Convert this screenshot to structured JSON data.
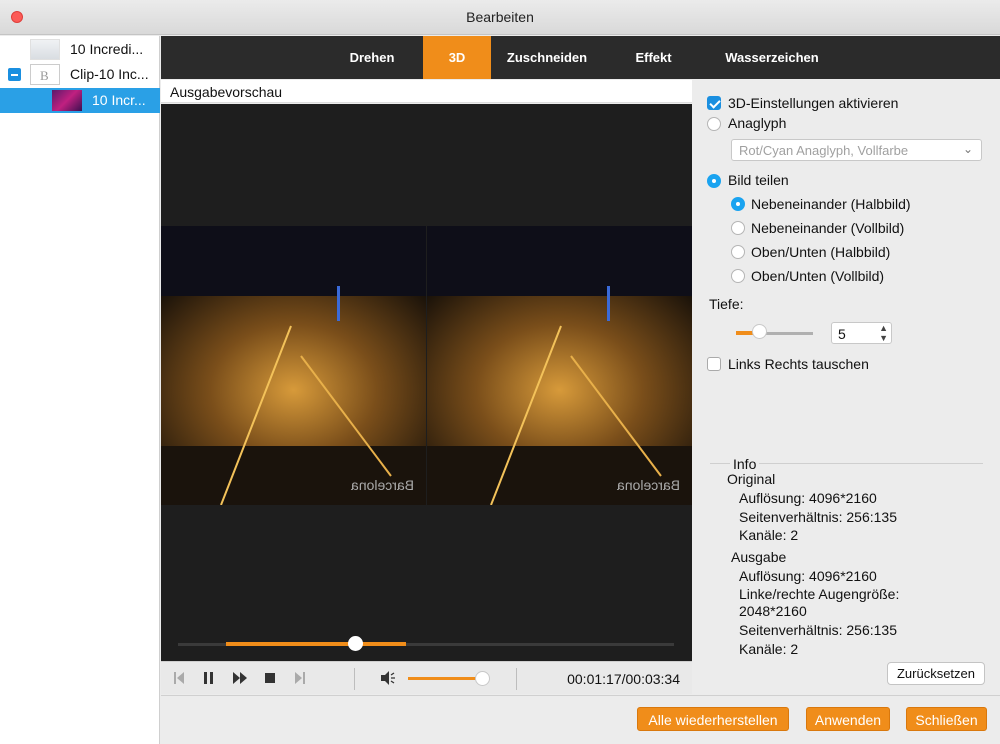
{
  "window": {
    "title": "Bearbeiten"
  },
  "sidebar": {
    "items": [
      {
        "label": "10 Incredi..."
      },
      {
        "label": "Clip-10 Inc..."
      },
      {
        "label": "10 Incr..."
      }
    ]
  },
  "tabs": [
    {
      "label": "Drehen"
    },
    {
      "label": "3D"
    },
    {
      "label": "Zuschneiden"
    },
    {
      "label": "Effekt"
    },
    {
      "label": "Wasserzeichen"
    }
  ],
  "active_tab": "3D",
  "preview": {
    "label": "Ausgabevorschau",
    "watermark_text": "Barcelona",
    "seek_progress": 0.36,
    "volume_level": 0.85,
    "time": "00:01:17/00:03:34"
  },
  "settings": {
    "enable_3d": {
      "label": "3D-Einstellungen aktivieren",
      "checked": true
    },
    "anaglyph": {
      "label": "Anaglyph",
      "selected": false
    },
    "anaglyph_select": {
      "value": "Rot/Cyan Anaglyph, Vollfarbe"
    },
    "split": {
      "label": "Bild teilen",
      "selected": true
    },
    "split_options": [
      {
        "label": "Nebeneinander (Halbbild)",
        "selected": true
      },
      {
        "label": "Nebeneinander (Vollbild)",
        "selected": false
      },
      {
        "label": "Oben/Unten (Halbbild)",
        "selected": false
      },
      {
        "label": "Oben/Unten (Vollbild)",
        "selected": false
      }
    ],
    "depth": {
      "label": "Tiefe:",
      "value": "5",
      "level": 0.3
    },
    "swap": {
      "label": "Links Rechts tauschen",
      "checked": false
    }
  },
  "info": {
    "title": "Info",
    "original": {
      "heading": "Original",
      "resolution": "Auflösung: 4096*2160",
      "aspect": "Seitenverhältnis: 256:135",
      "channels": "Kanäle: 2"
    },
    "output": {
      "heading": "Ausgabe",
      "resolution": "Auflösung: 4096*2160",
      "eye_size_label": "Linke/rechte Augengröße:",
      "eye_size_value": "2048*2160",
      "aspect": "Seitenverhältnis: 256:135",
      "channels": "Kanäle: 2"
    },
    "reset_label": "Zurücksetzen"
  },
  "buttons": {
    "restore_all": "Alle wiederherstellen",
    "apply": "Anwenden",
    "close": "Schließen"
  },
  "colors": {
    "accent": "#f08d1a",
    "selection": "#2aa0e6",
    "dark_bg": "#2b2b2b"
  }
}
